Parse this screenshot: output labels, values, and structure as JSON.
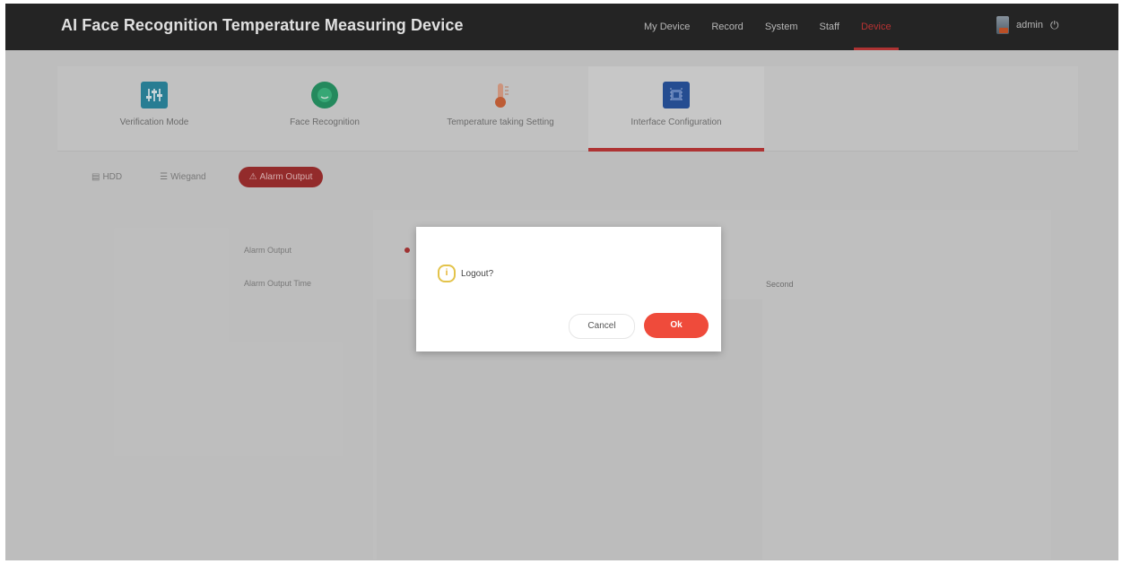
{
  "header": {
    "title": "AI Face Recognition Temperature Measuring Device",
    "nav": [
      "My Device",
      "Record",
      "System",
      "Staff",
      "Device"
    ],
    "active_nav_index": 4,
    "user": "admin",
    "user_icon": "user-avatar-icon",
    "logout_icon": "power-icon"
  },
  "tabs": [
    {
      "label": "Verification Mode",
      "icon": "sliders-icon"
    },
    {
      "label": "Face Recognition",
      "icon": "face-icon"
    },
    {
      "label": "Temperature taking Setting",
      "icon": "thermometer-icon"
    },
    {
      "label": "Interface Configuration",
      "icon": "chip-icon"
    }
  ],
  "active_tab_index": 3,
  "sub_tabs": [
    {
      "label": "HDD",
      "icon": "disk-icon"
    },
    {
      "label": "Wiegand",
      "icon": "list-icon"
    },
    {
      "label": "Alarm Output",
      "icon": "alarm-icon"
    }
  ],
  "active_sub_tab_index": 2,
  "form": {
    "alarm_output_label": "Alarm Output",
    "alarm_output_time_label": "Alarm Output Time",
    "unit": "Second"
  },
  "dialog": {
    "message": "Logout?",
    "cancel_label": "Cancel",
    "ok_label": "Ok",
    "icon": "info-icon"
  },
  "colors": {
    "accent": "#ef4b3b",
    "header_bg": "#2a2a2a",
    "warning": "#e3c34a"
  }
}
